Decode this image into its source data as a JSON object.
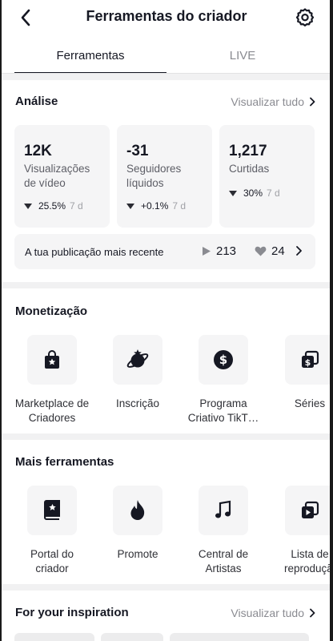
{
  "header": {
    "title": "Ferramentas do criador"
  },
  "tabs": [
    {
      "label": "Ferramentas"
    },
    {
      "label": "LIVE"
    }
  ],
  "analytics": {
    "title": "Análise",
    "see_all": "Visualizar tudo",
    "cards": [
      {
        "value": "12K",
        "label": "Visualizações de vídeo",
        "change": "25.5%",
        "period": "7 d"
      },
      {
        "value": "-31",
        "label": "Seguidores líquidos",
        "change": "+0.1%",
        "period": "7 d"
      },
      {
        "value": "1,217",
        "label": "Curtidas",
        "change": "30%",
        "period": "7 d"
      }
    ],
    "recent": {
      "label": "A tua publicação mais recente",
      "plays": "213",
      "likes": "24"
    }
  },
  "monetization": {
    "title": "Monetização",
    "items": [
      {
        "label": "Marketplace de Criadores",
        "icon": "shopping-bag-star-icon"
      },
      {
        "label": "Inscrição",
        "icon": "subscription-planet-icon"
      },
      {
        "label": "Programa Criativo TikT…",
        "icon": "dollar-coin-icon"
      },
      {
        "label": "Séries",
        "icon": "series-dollar-icon"
      }
    ]
  },
  "more_tools": {
    "title": "Mais ferramentas",
    "items": [
      {
        "label": "Portal do criador",
        "icon": "book-star-icon"
      },
      {
        "label": "Promote",
        "icon": "flame-icon"
      },
      {
        "label": "Central de Artistas",
        "icon": "music-note-icon"
      },
      {
        "label": "Lista de reprodução",
        "icon": "playlist-icon"
      }
    ]
  },
  "inspiration": {
    "title": "For your inspiration",
    "see_all": "Visualizar tudo"
  }
}
